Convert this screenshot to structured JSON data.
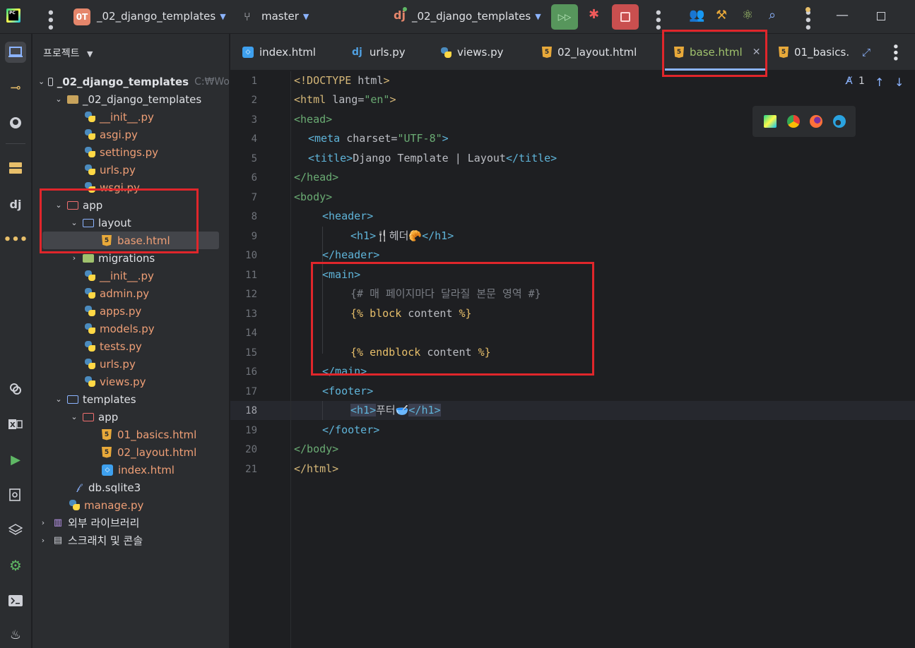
{
  "topbar": {
    "project_badge": "0T",
    "project_name": "_02_django_templates",
    "branch": "master",
    "run_config": "_02_django_templates",
    "run_config_icon": "dj"
  },
  "toolstrip": {
    "icons": [
      "project-icon",
      "commit-icon",
      "github-icon",
      "database-icon",
      "django-icon",
      "more-icon",
      "python-console-icon",
      "excel-icon",
      "run-icon",
      "search-icon",
      "layers-icon",
      "settings-icon",
      "terminal-icon",
      "notifications-icon"
    ]
  },
  "project_panel": {
    "title": "프로젝트",
    "root": "_02_django_templates",
    "root_path": "C:₩Wo",
    "items": [
      {
        "label": "_02_django_templates"
      },
      {
        "label": "__init__.py"
      },
      {
        "label": "asgi.py"
      },
      {
        "label": "settings.py"
      },
      {
        "label": "urls.py"
      },
      {
        "label": "wsgi.py"
      },
      {
        "label": "app"
      },
      {
        "label": "layout"
      },
      {
        "label": "base.html"
      },
      {
        "label": "migrations"
      },
      {
        "label": "__init__.py"
      },
      {
        "label": "admin.py"
      },
      {
        "label": "apps.py"
      },
      {
        "label": "models.py"
      },
      {
        "label": "tests.py"
      },
      {
        "label": "urls.py"
      },
      {
        "label": "views.py"
      },
      {
        "label": "templates"
      },
      {
        "label": "app"
      },
      {
        "label": "01_basics.html"
      },
      {
        "label": "02_layout.html"
      },
      {
        "label": "index.html"
      },
      {
        "label": "db.sqlite3"
      },
      {
        "label": "manage.py"
      },
      {
        "label": "외부 라이브러리"
      },
      {
        "label": "스크래치 및 콘솔"
      }
    ]
  },
  "tabs": [
    {
      "label": "index.html"
    },
    {
      "label": "urls.py"
    },
    {
      "label": "views.py"
    },
    {
      "label": "02_layout.html"
    },
    {
      "label": "base.html",
      "active": true
    },
    {
      "label": "01_basics."
    }
  ],
  "editor": {
    "inspection_count": "1",
    "line_numbers": [
      "1",
      "2",
      "3",
      "4",
      "5",
      "6",
      "7",
      "8",
      "9",
      "10",
      "11",
      "12",
      "13",
      "14",
      "15",
      "16",
      "17",
      "18",
      "19",
      "20",
      "21"
    ],
    "current_line": "18",
    "code": {
      "l1_a": "<!DOCTYPE",
      "l1_b": " html",
      "l1_c": ">",
      "l2_a": "<html ",
      "l2_b": "lang",
      "l2_c": "=",
      "l2_d": "\"en\"",
      "l2_e": ">",
      "l3": "<head>",
      "l4_a": "<meta ",
      "l4_b": "charset",
      "l4_c": "=",
      "l4_d": "\"UTF-8\"",
      "l4_e": ">",
      "l5_a": "<title>",
      "l5_b": "Django Template | Layout",
      "l5_c": "</title>",
      "l6": "</head>",
      "l7": "<body>",
      "l8": "<header>",
      "l9_a": "<h1>",
      "l9_b": "🍴헤더🥐",
      "l9_c": "</h1>",
      "l10": "</header>",
      "l11": "<main>",
      "l12": "{# 매 페이지마다 달라질 본문 영역 #}",
      "l13_a": "{% ",
      "l13_b": "block",
      "l13_c": " content ",
      "l13_d": "%}",
      "l14": "",
      "l15_a": "{% ",
      "l15_b": "endblock",
      "l15_c": " content ",
      "l15_d": "%}",
      "l16": "</main>",
      "l17": "<footer>",
      "l18_a": "<h1>",
      "l18_b": "푸터🥣",
      "l18_c": "</h1>",
      "l19": "</footer>",
      "l20": "</body>",
      "l21": "</html>"
    }
  },
  "colors": {
    "highlight_box": "#e0262b",
    "accent": "#8cb4ff"
  }
}
